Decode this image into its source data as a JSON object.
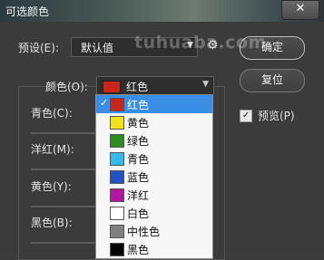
{
  "window": {
    "title": "可选颜色",
    "close_glyph": "✕"
  },
  "preset": {
    "label": "预设(E):",
    "value": "默认值"
  },
  "buttons": {
    "ok": "确定",
    "reset": "复位"
  },
  "preview": {
    "label": "预览(P)",
    "checked": true
  },
  "colors": {
    "label": "颜色(O):",
    "value": "红色",
    "value_color": "#c8261a"
  },
  "adjust_labels": [
    "青色(C):",
    "洋红(M):",
    "黄色(Y):",
    "黑色(B):"
  ],
  "dropdown": {
    "selected_index": 0,
    "items": [
      {
        "label": "红色",
        "color": "#c8261a"
      },
      {
        "label": "黄色",
        "color": "#f2e21a"
      },
      {
        "label": "绿色",
        "color": "#2f8a1f"
      },
      {
        "label": "青色",
        "color": "#35b8ea"
      },
      {
        "label": "蓝色",
        "color": "#2452c4"
      },
      {
        "label": "洋红",
        "color": "#b2169c"
      },
      {
        "label": "白色",
        "color": "#ffffff"
      },
      {
        "label": "中性色",
        "color": "#808080"
      },
      {
        "label": "黑色",
        "color": "#000000"
      }
    ]
  },
  "watermark": "tuhuaba.com"
}
